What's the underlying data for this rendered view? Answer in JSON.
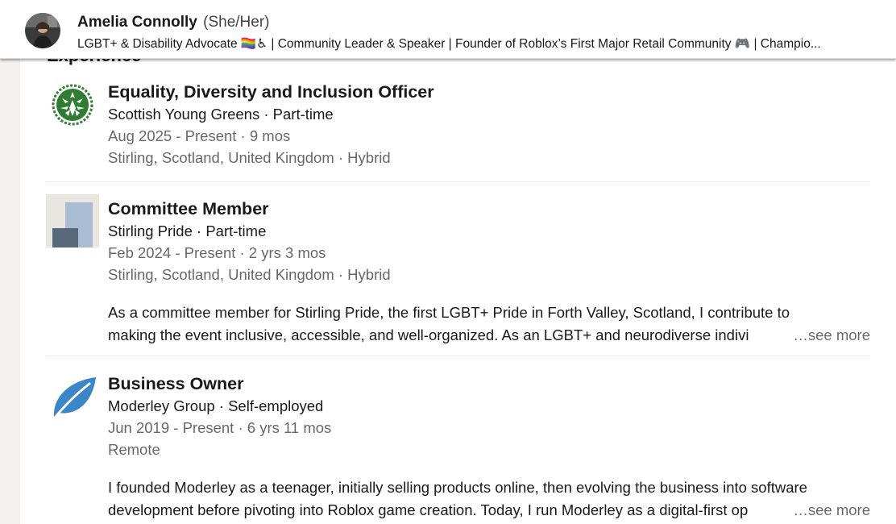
{
  "header": {
    "name": "Amelia Connolly",
    "pronouns": "(She/Her)",
    "headline": "LGBT+ & Disability Advocate 🏳️‍🌈♿ | Community Leader & Speaker | Founder of Roblox’s First Major Retail Community 🎮 | Champio..."
  },
  "section": {
    "title": "Experience"
  },
  "experiences": [
    {
      "title": "Equality, Diversity and Inclusion Officer",
      "org_line": "Scottish Young Greens · Part-time",
      "dates": "Aug 2025 - Present · 9 mos",
      "location": "Stirling, Scotland, United Kingdom · Hybrid",
      "logo_icon": "thistle-logo-icon"
    },
    {
      "title": "Committee Member",
      "org_line": "Stirling Pride · Part-time",
      "dates": "Feb 2024 - Present · 2 yrs 3 mos",
      "location": "Stirling, Scotland, United Kingdom · Hybrid",
      "description_line1": "As a committee member for Stirling Pride, the first LGBT+ Pride in Forth Valley, Scotland, I contribute to",
      "description_line2": "making the event inclusive, accessible, and well-organized. As an LGBT+ and neurodiverse indivi",
      "see_more": "…see more",
      "logo_icon": "placeholder-company-logo-icon"
    },
    {
      "title": "Business Owner",
      "org_line": "Moderley Group · Self-employed",
      "dates": "Jun 2019 - Present · 6 yrs 11 mos",
      "location": "Remote",
      "description_line1": "I founded Moderley as a teenager, initially selling products online, then evolving the business into software",
      "description_line2": "development before pivoting into Roblox game creation. Today, I run Moderley as a digital-first op",
      "see_more": "…see more",
      "logo_icon": "leaf-logo-icon"
    }
  ],
  "colors": {
    "page_bg": "#f4f2ee",
    "card_bg": "#ffffff",
    "text_primary": "rgba(0,0,0,0.9)",
    "text_muted": "rgba(0,0,0,0.6)",
    "leaf_blue": "#3a86c8",
    "thistle_green": "#2e7d32"
  }
}
